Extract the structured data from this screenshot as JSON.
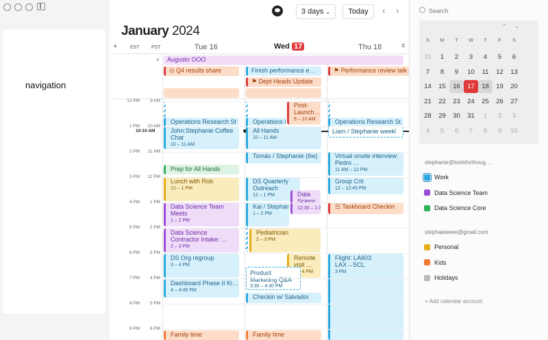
{
  "window": {
    "nav_placeholder": "navigation"
  },
  "toolbar": {
    "view": "3 days",
    "today": "Today",
    "prev": "‹",
    "next": "›"
  },
  "title": {
    "month": "January",
    "year": "2024"
  },
  "timezones": {
    "add": "+",
    "tz1": "EST",
    "tz2": "PST",
    "collapse": "⌅"
  },
  "days": [
    {
      "label": "Tue 16"
    },
    {
      "label": "Wed",
      "badge": "17"
    },
    {
      "label": "Thu 18"
    }
  ],
  "plusminus": "±",
  "hours": [
    {
      "est": "12 PM",
      "pst": "9 AM"
    },
    {
      "est": "1 PM",
      "pst": "10 AM"
    },
    {
      "est": "2 PM",
      "pst": "11 AM"
    },
    {
      "est": "3 PM",
      "pst": "12 PM"
    },
    {
      "est": "4 PM",
      "pst": "1 PM"
    },
    {
      "est": "5 PM",
      "pst": "2 PM"
    },
    {
      "est": "6 PM",
      "pst": "3 PM"
    },
    {
      "est": "7 PM",
      "pst": "4 PM"
    },
    {
      "est": "8 PM",
      "pst": "5 PM"
    },
    {
      "est": "9 PM",
      "pst": "6 PM"
    }
  ],
  "now": "10:10 AM",
  "allday": {
    "ooo": "Augusto OOO",
    "q4": "Q4 results share",
    "finish": "Finish performance e…",
    "dept": "Dept Heads Update",
    "perf": "Performance review talk"
  },
  "events": {
    "opsTue": "Operations Research St",
    "coffeeTitle": "John:Stephanie Coffee Chat",
    "coffeeTime": "10 – 11 AM",
    "prep": "Prep for All Hands",
    "lunch": "Lunch with Rob",
    "lunchTime": "12 – 1 PM",
    "dsMeet": "Data Science Team Meets",
    "dsMeetTime": "1 – 2 PM",
    "contractor": "Data Science Contractor Intake: …",
    "contractorTime": "2 – 3 PM",
    "dsorg": "DS Org regroup",
    "dsorgTime": "3 – 4 PM",
    "dash": "Dashboard Phase II Ki…",
    "dashTime": "4 – 4:45 PM",
    "famTue": "Family time",
    "postLaunch": "Post-Launch…",
    "postLaunchTime": "9 – 10 AM",
    "opsWed": "Operations Ri",
    "allHands": "All Hands",
    "allHandsTime": "10 – 11 AM",
    "tomas": "Tomás / Stephanie (6w)",
    "dsq": "DS Quarterly Outreach",
    "dsqTime": "12 – 1 PM",
    "dsci": "Data Scienc…",
    "dsciTime": "12:30 – 1:3",
    "kai": "Kai / Stephan",
    "kaiTime": "1 – 2 PM",
    "pedi": "Pediatrician",
    "pediTime": "2 – 3 PM",
    "remote": "Remote visit …",
    "remoteTime": "3 – 4 PM",
    "pmqa": "Product Marketing Q&A",
    "pmqaTime": "3:30 – 4:30 PM",
    "checkin": "Checkin w/ Salvador",
    "famWed": "Family time",
    "opsThu": "Operations Research St",
    "liam": "Liam / Stephanie weekl",
    "virtual": "Virtual onsite interview: Pedro …",
    "virtualTime": "11 AM – 12 PM",
    "group": "Group Crit",
    "groupTime": "12 – 12:45 PM",
    "taskboard": "Taskboard Checkin",
    "flight": "Flight: LA603 LAX→SCL",
    "flightTime": "3 PM"
  },
  "sidebar": {
    "search_placeholder": "Search",
    "weekdays": [
      "S",
      "M",
      "T",
      "W",
      "T",
      "F",
      "S"
    ],
    "weeks": [
      [
        "31",
        "1",
        "2",
        "3",
        "4",
        "5",
        "6"
      ],
      [
        "7",
        "8",
        "9",
        "10",
        "11",
        "12",
        "13"
      ],
      [
        "14",
        "15",
        "16",
        "17",
        "18",
        "19",
        "20"
      ],
      [
        "21",
        "22",
        "23",
        "24",
        "25",
        "26",
        "27"
      ],
      [
        "28",
        "29",
        "30",
        "31",
        "1",
        "2",
        "3"
      ],
      [
        "4",
        "5",
        "6",
        "7",
        "8",
        "9",
        "10"
      ]
    ],
    "account1": "stephanie@toolsforthoug…",
    "calendars1": [
      {
        "name": "Work",
        "color": "#28a8e0"
      },
      {
        "name": "Data Science Team",
        "color": "#9a4dd6"
      },
      {
        "name": "Data Science Core",
        "color": "#2fb35a"
      }
    ],
    "account2": "stephaleeeee@gmail.com",
    "calendars2": [
      {
        "name": "Personal",
        "color": "#e5ad19"
      },
      {
        "name": "Kids",
        "color": "#f07a32"
      },
      {
        "name": "Holidays",
        "color": "#bbbbbb"
      }
    ],
    "add_account": "+ Add calendar account"
  }
}
